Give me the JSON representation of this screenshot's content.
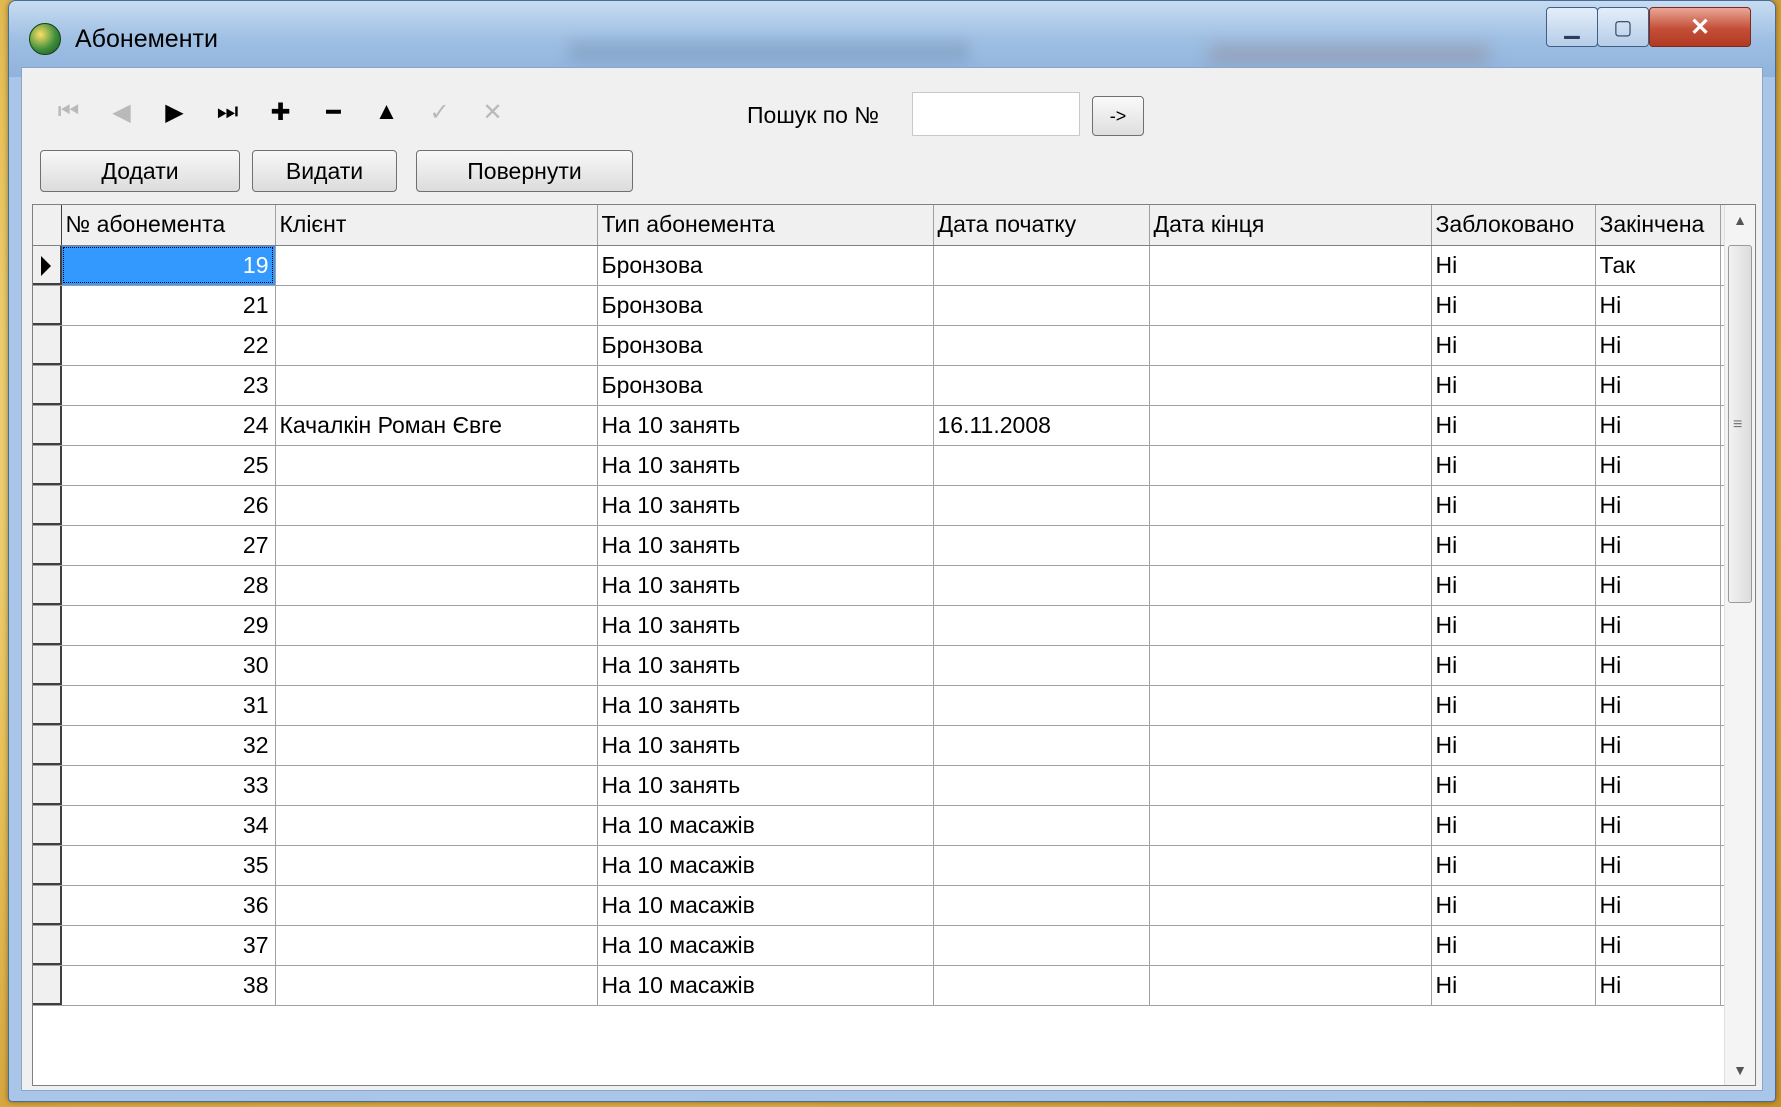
{
  "window": {
    "title": "Абонементи"
  },
  "nav_icons": [
    {
      "name": "first-record-icon",
      "glyph": "⏮",
      "enabled": false
    },
    {
      "name": "prior-record-icon",
      "glyph": "◀",
      "enabled": false
    },
    {
      "name": "next-record-icon",
      "glyph": "▶",
      "enabled": true
    },
    {
      "name": "last-record-icon",
      "glyph": "⏭",
      "enabled": true
    },
    {
      "name": "insert-record-icon",
      "glyph": "✚",
      "enabled": true
    },
    {
      "name": "delete-record-icon",
      "glyph": "━",
      "enabled": true
    },
    {
      "name": "edit-record-icon",
      "glyph": "▲",
      "enabled": true
    },
    {
      "name": "post-record-icon",
      "glyph": "✓",
      "enabled": false
    },
    {
      "name": "cancel-record-icon",
      "glyph": "✕",
      "enabled": false
    }
  ],
  "search": {
    "label": "Пошук по №",
    "value": "",
    "go_label": "->"
  },
  "actions": {
    "add": "Додати",
    "issue": "Видати",
    "return": "Повернути"
  },
  "grid": {
    "columns": [
      "№ абонемента",
      "Клієнт",
      "Тип абонемента",
      "Дата початку",
      "Дата кінця",
      "Заблоковано",
      "Закінчена"
    ],
    "rows": [
      [
        "19",
        "",
        "Бронзова",
        "",
        "",
        "Ні",
        "Так"
      ],
      [
        "21",
        "",
        "Бронзова",
        "",
        "",
        "Ні",
        "Ні"
      ],
      [
        "22",
        "",
        "Бронзова",
        "",
        "",
        "Ні",
        "Ні"
      ],
      [
        "23",
        "",
        "Бронзова",
        "",
        "",
        "Ні",
        "Ні"
      ],
      [
        "24",
        "Качалкін Роман  Євге",
        "На 10 занять",
        "16.11.2008",
        "",
        "Ні",
        "Ні"
      ],
      [
        "25",
        "",
        "На 10 занять",
        "",
        "",
        "Ні",
        "Ні"
      ],
      [
        "26",
        "",
        "На 10 занять",
        "",
        "",
        "Ні",
        "Ні"
      ],
      [
        "27",
        "",
        "На 10 занять",
        "",
        "",
        "Ні",
        "Ні"
      ],
      [
        "28",
        "",
        "На 10 занять",
        "",
        "",
        "Ні",
        "Ні"
      ],
      [
        "29",
        "",
        "На 10 занять",
        "",
        "",
        "Ні",
        "Ні"
      ],
      [
        "30",
        "",
        "На 10 занять",
        "",
        "",
        "Ні",
        "Ні"
      ],
      [
        "31",
        "",
        "На 10 занять",
        "",
        "",
        "Ні",
        "Ні"
      ],
      [
        "32",
        "",
        "На 10 занять",
        "",
        "",
        "Ні",
        "Ні"
      ],
      [
        "33",
        "",
        "На 10 занять",
        "",
        "",
        "Ні",
        "Ні"
      ],
      [
        "34",
        "",
        "На 10 масажів",
        "",
        "",
        "Ні",
        "Ні"
      ],
      [
        "35",
        "",
        "На 10 масажів",
        "",
        "",
        "Ні",
        "Ні"
      ],
      [
        "36",
        "",
        "На 10 масажів",
        "",
        "",
        "Ні",
        "Ні"
      ],
      [
        "37",
        "",
        "На 10 масажів",
        "",
        "",
        "Ні",
        "Ні"
      ],
      [
        "38",
        "",
        "На 10 масажів",
        "",
        "",
        "Ні",
        "Ні"
      ]
    ]
  }
}
